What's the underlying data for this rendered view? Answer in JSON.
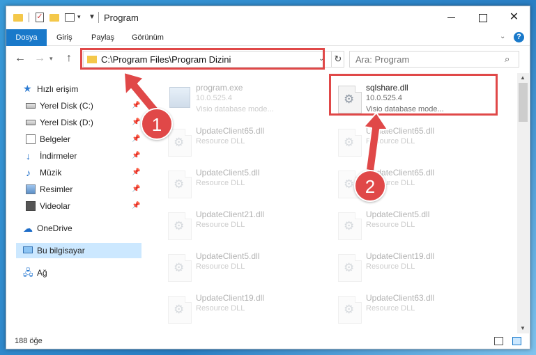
{
  "window": {
    "title": "Program",
    "controls": {
      "minimize": "minimize",
      "maximize": "maximize",
      "close": "✕"
    }
  },
  "ribbon": {
    "tabs": [
      "Dosya",
      "Giriş",
      "Paylaş",
      "Görünüm"
    ],
    "help": "?"
  },
  "address": {
    "path": "C:\\Program Files\\Program Dizini",
    "search_placeholder": "Ara: Program"
  },
  "nav": {
    "quick_access": "Hızlı erişim",
    "items": [
      {
        "label": "Yerel Disk (C:)",
        "icon": "drive-icon",
        "pinned": true
      },
      {
        "label": "Yerel Disk (D:)",
        "icon": "drive-icon",
        "pinned": true
      },
      {
        "label": "Belgeler",
        "icon": "documents-icon",
        "pinned": true
      },
      {
        "label": "İndirmeler",
        "icon": "downloads-icon",
        "pinned": true
      },
      {
        "label": "Müzik",
        "icon": "music-icon",
        "pinned": true
      },
      {
        "label": "Resimler",
        "icon": "pictures-icon",
        "pinned": true
      },
      {
        "label": "Videolar",
        "icon": "videos-icon",
        "pinned": true
      }
    ],
    "onedrive": "OneDrive",
    "this_pc": "Bu bilgisayar",
    "network": "Ağ"
  },
  "files": [
    {
      "name": "program.exe",
      "line2": "10.0.525.4",
      "line3": "Visio database mode...",
      "faded": true
    },
    {
      "name": "sqlshare.dll",
      "line2": "10.0.525.4",
      "line3": "Visio database mode...",
      "faded": false
    },
    {
      "name": "UpdateClient65.dll",
      "line2": "Resource DLL",
      "faded": true
    },
    {
      "name": "UpdateClient65.dll",
      "line2": "Resource DLL",
      "faded": true
    },
    {
      "name": "UpdateClient5.dll",
      "line2": "Resource DLL",
      "faded": true
    },
    {
      "name": "UpdateClient65.dll",
      "line2": "Resource DLL",
      "faded": true
    },
    {
      "name": "UpdateClient21.dll",
      "line2": "Resource DLL",
      "faded": true
    },
    {
      "name": "UpdateClient5.dll",
      "line2": "Resource DLL",
      "faded": true
    },
    {
      "name": "UpdateClient5.dll",
      "line2": "Resource DLL",
      "faded": true
    },
    {
      "name": "UpdateClient19.dll",
      "line2": "Resource DLL",
      "faded": true
    },
    {
      "name": "UpdateClient19.dll",
      "line2": "Resource DLL",
      "faded": true
    },
    {
      "name": "UpdateClient63.dll",
      "line2": "Resource DLL",
      "faded": true
    }
  ],
  "status": {
    "count": "188 öğe"
  },
  "annotations": {
    "step1": "1",
    "step2": "2",
    "color": "#e04848"
  }
}
